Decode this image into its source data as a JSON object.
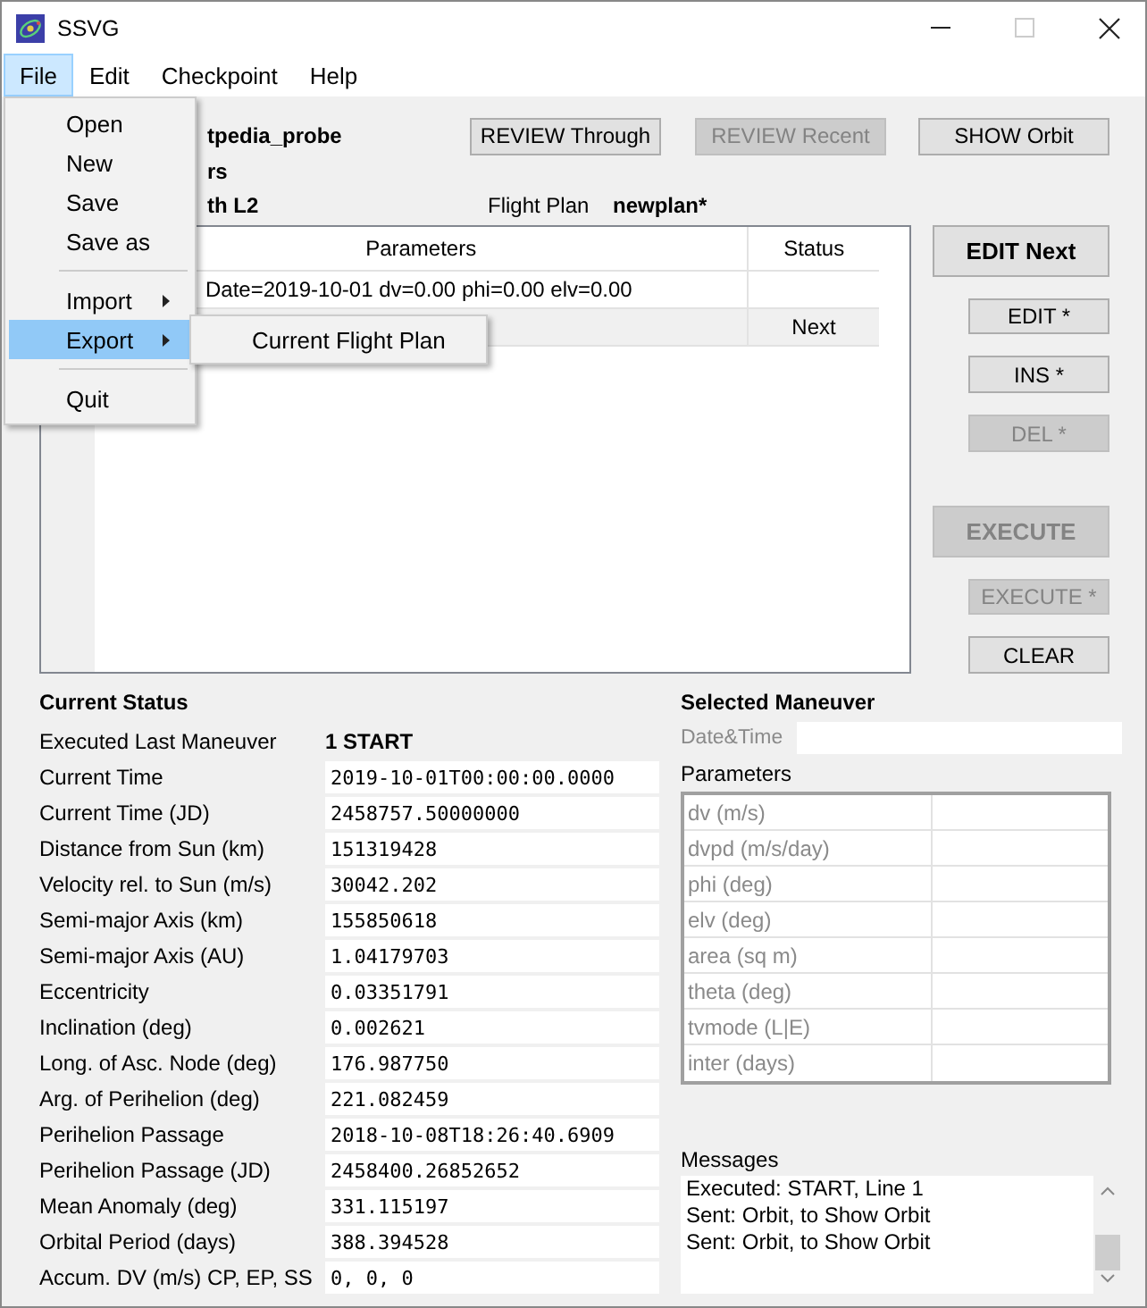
{
  "window": {
    "title": "SSVG"
  },
  "menu_bar": [
    {
      "label": "File",
      "selected": true
    },
    {
      "label": "Edit",
      "selected": false
    },
    {
      "label": "Checkpoint",
      "selected": false
    },
    {
      "label": "Help",
      "selected": false
    }
  ],
  "file_menu": [
    {
      "label": "Open",
      "kind": "item",
      "selected": false,
      "separator_before": false
    },
    {
      "label": "New",
      "kind": "item",
      "selected": false,
      "separator_before": false
    },
    {
      "label": "Save",
      "kind": "item",
      "selected": false,
      "separator_before": false
    },
    {
      "label": "Save as",
      "kind": "item",
      "selected": false,
      "separator_before": false
    },
    {
      "label": "Import",
      "kind": "submenu",
      "selected": false,
      "separator_before": true
    },
    {
      "label": "Export",
      "kind": "submenu",
      "selected": true,
      "separator_before": false
    },
    {
      "label": "Quit",
      "kind": "item",
      "selected": false,
      "separator_before": true
    }
  ],
  "export_submenu": [
    "Current Flight Plan"
  ],
  "probe": {
    "name": "tpedia_probe",
    "line_2": "rs",
    "line_3": "th L2"
  },
  "flight_plan": {
    "label": "Flight Plan",
    "value": "newplan*"
  },
  "top_buttons": [
    {
      "label": "REVIEW Through",
      "disabled": false
    },
    {
      "label": "REVIEW Recent",
      "disabled": true
    },
    {
      "label": "SHOW Orbit",
      "disabled": false
    }
  ],
  "plan_table": {
    "columns": [
      "Parameters",
      "Status"
    ],
    "rows": [
      {
        "parameters": "Date=2019-10-01 dv=0.00 phi=0.00 elv=0.00",
        "selected": false
      },
      {
        "status": "Next",
        "selected": true
      }
    ]
  },
  "side_buttons": [
    {
      "label": "EDIT Next",
      "kind": "large",
      "disabled": false
    },
    {
      "label": "EDIT *",
      "kind": "small",
      "disabled": false
    },
    {
      "label": "INS *",
      "kind": "small",
      "disabled": false
    },
    {
      "label": "DEL *",
      "kind": "small",
      "disabled": true
    },
    {
      "label": "EXECUTE",
      "kind": "large",
      "disabled": true
    },
    {
      "label": "EXECUTE *",
      "kind": "small",
      "disabled": true
    },
    {
      "label": "CLEAR",
      "kind": "small",
      "disabled": false
    }
  ],
  "current_status": {
    "title": "Current Status",
    "rows": [
      {
        "label": "Executed Last Maneuver",
        "value": "1 START",
        "kind": "text"
      },
      {
        "label": "Current Time",
        "value": "2019-10-01T00:00:00.0000",
        "kind": "field"
      },
      {
        "label": "Current Time (JD)",
        "value": "2458757.50000000",
        "kind": "field"
      },
      {
        "label": "Distance from Sun (km)",
        "value": "151319428",
        "kind": "field"
      },
      {
        "label": "Velocity rel. to Sun (m/s)",
        "value": "30042.202",
        "kind": "field"
      },
      {
        "label": "Semi-major Axis (km)",
        "value": "155850618",
        "kind": "field"
      },
      {
        "label": "Semi-major Axis (AU)",
        "value": "1.04179703",
        "kind": "field"
      },
      {
        "label": "Eccentricity",
        "value": "0.03351791",
        "kind": "field"
      },
      {
        "label": "Inclination (deg)",
        "value": "0.002621",
        "kind": "field"
      },
      {
        "label": "Long. of Asc. Node (deg)",
        "value": "176.987750",
        "kind": "field"
      },
      {
        "label": "Arg. of Perihelion (deg)",
        "value": "221.082459",
        "kind": "field"
      },
      {
        "label": "Perihelion Passage",
        "value": "2018-10-08T18:26:40.6909",
        "kind": "field"
      },
      {
        "label": "Perihelion Passage (JD)",
        "value": "2458400.26852652",
        "kind": "field"
      },
      {
        "label": "Mean Anomaly (deg)",
        "value": "331.115197",
        "kind": "field"
      },
      {
        "label": "Orbital Period (days)",
        "value": "388.394528",
        "kind": "field"
      },
      {
        "label": "Accum. DV (m/s) CP, EP, SS",
        "value": "0, 0, 0",
        "kind": "field"
      }
    ]
  },
  "selected_maneuver": {
    "title": "Selected Maneuver",
    "date_time": {
      "label": "Date&Time",
      "disabled": true
    },
    "parameters_title": "Parameters",
    "parameters": [
      {
        "label": "dv (m/s)",
        "disabled": true
      },
      {
        "label": "dvpd (m/s/day)",
        "disabled": true
      },
      {
        "label": "phi (deg)",
        "disabled": true
      },
      {
        "label": "elv (deg)",
        "disabled": true
      },
      {
        "label": "area (sq m)",
        "disabled": true
      },
      {
        "label": "theta (deg)",
        "disabled": true
      },
      {
        "label": "tvmode (L|E)",
        "disabled": true
      },
      {
        "label": "inter (days)",
        "disabled": true
      }
    ]
  },
  "messages": {
    "title": "Messages",
    "lines": [
      "Executed: START, Line 1",
      "Sent: Orbit, to Show Orbit",
      "Sent: Orbit, to Show Orbit"
    ]
  }
}
